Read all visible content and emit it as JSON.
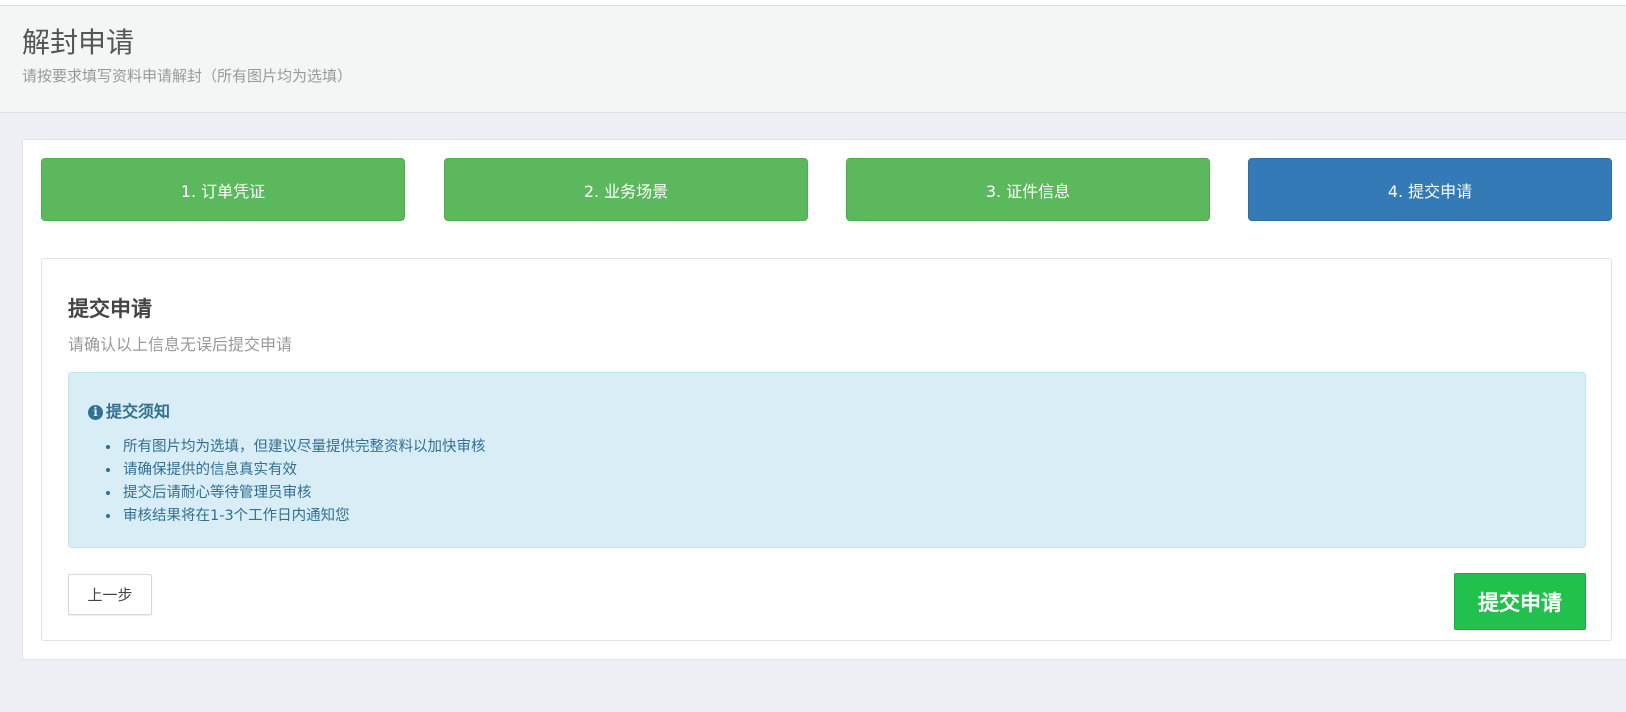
{
  "header": {
    "title": "解封申请",
    "subtitle": "请按要求填写资料申请解封（所有图片均为选填）"
  },
  "steps": [
    {
      "label": "1. 订单凭证",
      "state": "done"
    },
    {
      "label": "2. 业务场景",
      "state": "done"
    },
    {
      "label": "3. 证件信息",
      "state": "done"
    },
    {
      "label": "4. 提交申请",
      "state": "active"
    }
  ],
  "section": {
    "title": "提交申请",
    "description": "请确认以上信息无误后提交申请"
  },
  "notice": {
    "icon": "info-circle-icon",
    "title": "提交须知",
    "items": [
      "所有图片均为选填，但建议尽量提供完整资料以加快审核",
      "请确保提供的信息真实有效",
      "提交后请耐心等待管理员审核",
      "审核结果将在1-3个工作日内通知您"
    ]
  },
  "actions": {
    "prev_label": "上一步",
    "submit_label": "提交申请"
  },
  "colors": {
    "step_done": "#5cb85c",
    "step_active": "#337ab7",
    "submit": "#22c14d",
    "notice_bg": "#d9edf7",
    "notice_text": "#31708f"
  }
}
